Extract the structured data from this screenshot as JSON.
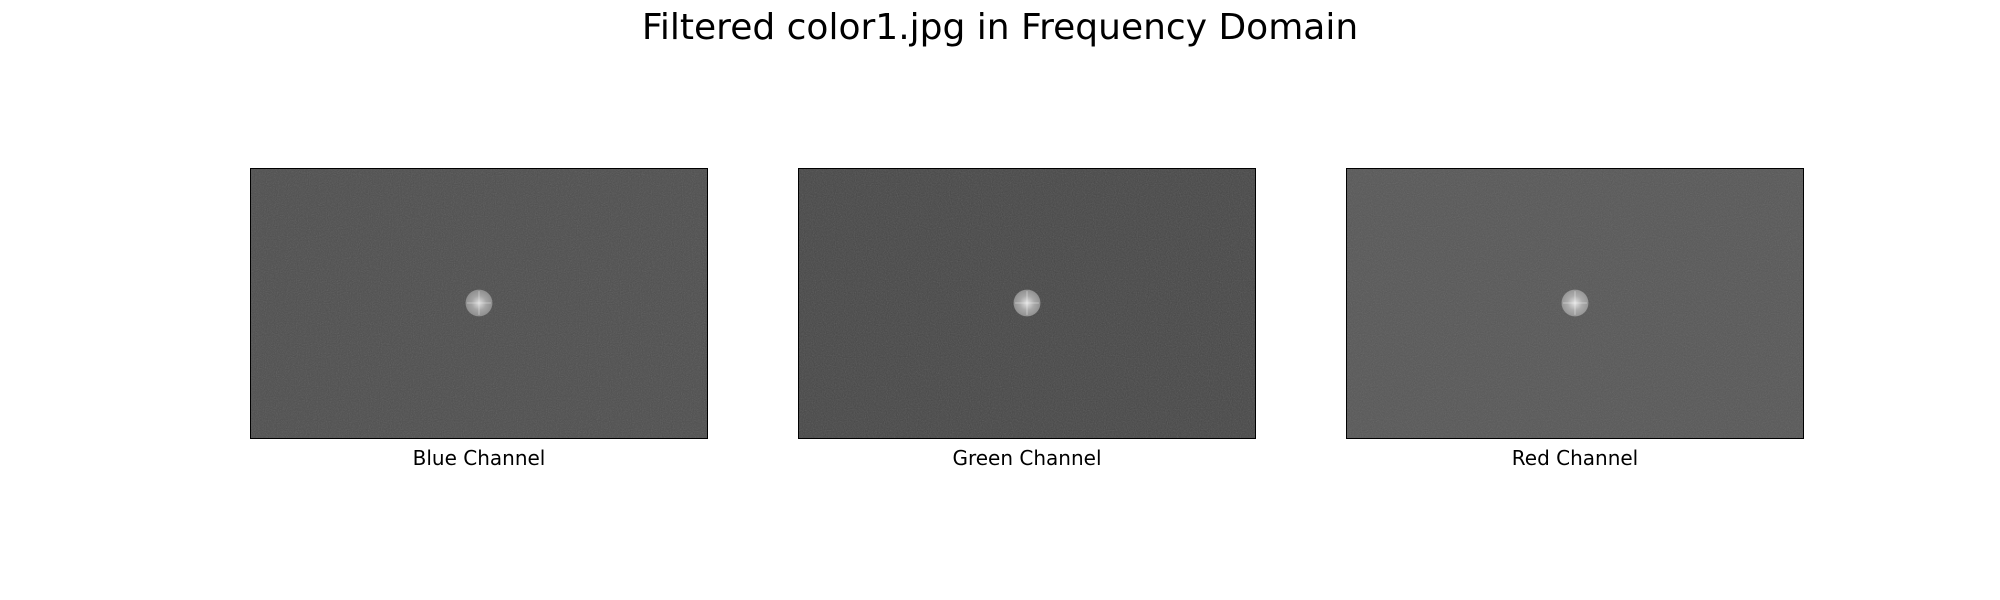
{
  "figure": {
    "title": "Filtered color1.jpg in Frequency Domain"
  },
  "panels": [
    {
      "label": "Blue Channel",
      "background": "#4e4e4e",
      "spot_color": "#9c9c9c"
    },
    {
      "label": "Green Channel",
      "background": "#474747",
      "spot_color": "#a2a2a2"
    },
    {
      "label": "Red Channel",
      "background": "#575757",
      "spot_color": "#a8a8a8"
    }
  ]
}
